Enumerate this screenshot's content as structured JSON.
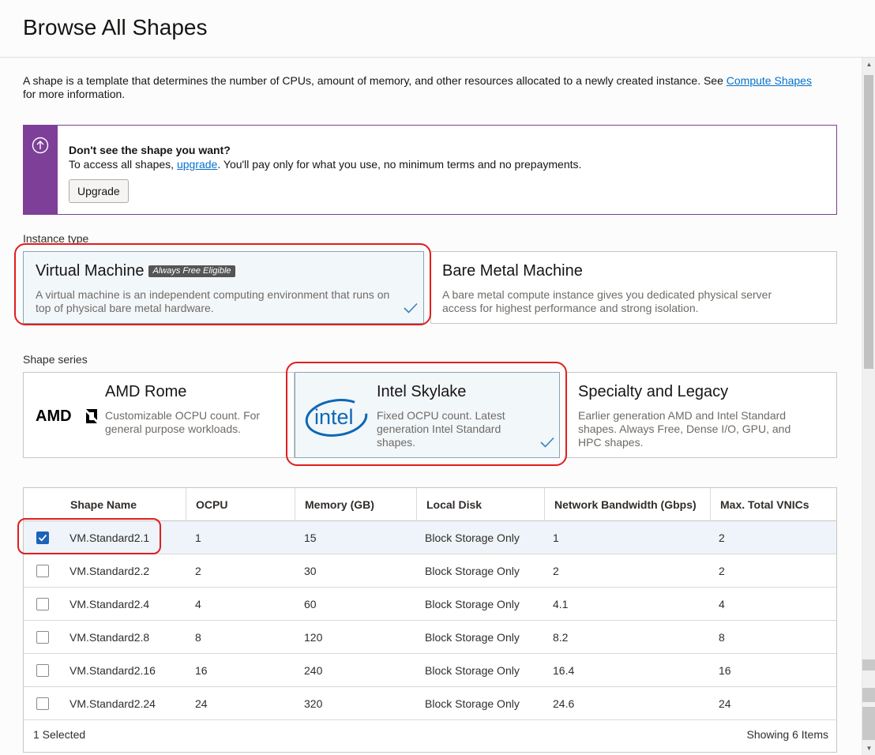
{
  "header": {
    "title": "Browse All Shapes"
  },
  "intro": {
    "text_before": "A shape is a template that determines the number of CPUs, amount of memory, and other resources allocated to a newly created instance. See ",
    "link": "Compute Shapes",
    "text_after": " for more information."
  },
  "banner": {
    "title": "Don't see the shape you want?",
    "text_before": "To access all shapes, ",
    "link": "upgrade",
    "text_after": ". You'll pay only for what you use, no minimum terms and no prepayments.",
    "button": "Upgrade",
    "accent": "#7d3f98"
  },
  "instance_type": {
    "label": "Instance type",
    "options": [
      {
        "title": "Virtual Machine",
        "badge": "Always Free Eligible",
        "desc": "A virtual machine is an independent computing environment that runs on top of physical bare metal hardware.",
        "selected": true
      },
      {
        "title": "Bare Metal Machine",
        "desc": "A bare metal compute instance gives you dedicated physical server access for highest performance and strong isolation.",
        "selected": false
      }
    ]
  },
  "shape_series": {
    "label": "Shape series",
    "options": [
      {
        "title": "AMD Rome",
        "logo": "AMD",
        "desc": "Customizable OCPU count. For general purpose workloads.",
        "selected": false
      },
      {
        "title": "Intel Skylake",
        "logo": "intel",
        "desc": "Fixed OCPU count. Latest generation Intel Standard shapes.",
        "selected": true
      },
      {
        "title": "Specialty and Legacy",
        "desc": "Earlier generation AMD and Intel Standard shapes. Always Free, Dense I/O, GPU, and HPC shapes.",
        "selected": false
      }
    ]
  },
  "table": {
    "columns": [
      "Shape Name",
      "OCPU",
      "Memory (GB)",
      "Local Disk",
      "Network Bandwidth (Gbps)",
      "Max. Total VNICs"
    ],
    "rows": [
      {
        "cells": [
          "VM.Standard2.1",
          "1",
          "15",
          "Block Storage Only",
          "1",
          "2"
        ],
        "checked": true
      },
      {
        "cells": [
          "VM.Standard2.2",
          "2",
          "30",
          "Block Storage Only",
          "2",
          "2"
        ],
        "checked": false
      },
      {
        "cells": [
          "VM.Standard2.4",
          "4",
          "60",
          "Block Storage Only",
          "4.1",
          "4"
        ],
        "checked": false
      },
      {
        "cells": [
          "VM.Standard2.8",
          "8",
          "120",
          "Block Storage Only",
          "8.2",
          "8"
        ],
        "checked": false
      },
      {
        "cells": [
          "VM.Standard2.16",
          "16",
          "240",
          "Block Storage Only",
          "16.4",
          "16"
        ],
        "checked": false
      },
      {
        "cells": [
          "VM.Standard2.24",
          "24",
          "320",
          "Block Storage Only",
          "24.6",
          "24"
        ],
        "checked": false
      }
    ],
    "footer_left": "1 Selected",
    "footer_right": "Showing 6 Items"
  },
  "colors": {
    "selection_outline": "#e01e1e",
    "checkbox_checked": "#1c63b8",
    "link": "#0572ce"
  }
}
